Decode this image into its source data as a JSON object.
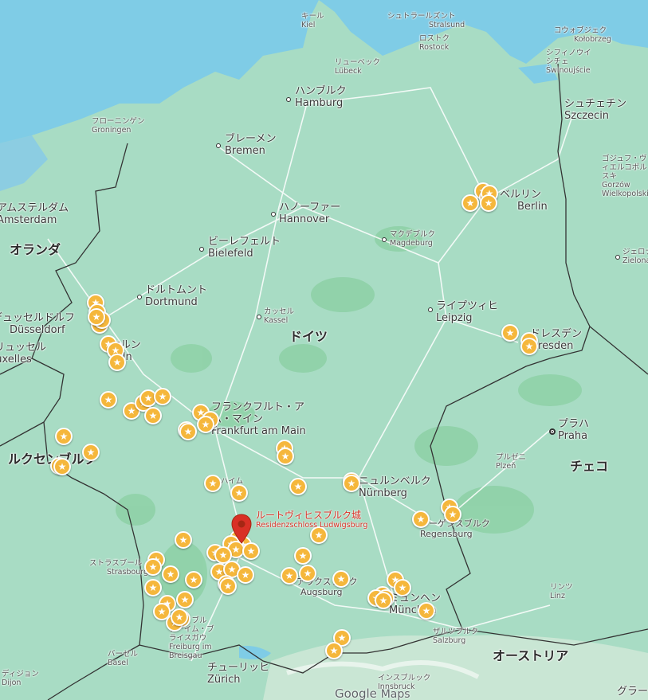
{
  "map": {
    "countries": [
      {
        "name": "ドイツ"
      },
      {
        "name": "オランダ"
      },
      {
        "name": "ルクセンブルク"
      },
      {
        "name": "チェコ"
      },
      {
        "name": "オーストリア"
      }
    ],
    "cities": [
      {
        "ja": "キール",
        "lat": "Kiel",
        "size": "s"
      },
      {
        "ja": "シュトラールズント",
        "lat": "Stralsund",
        "size": "s"
      },
      {
        "ja": "ロストク",
        "lat": "Rostock",
        "size": "s"
      },
      {
        "ja": "コウォブジェク",
        "lat": "Kołobrzeg",
        "size": "s"
      },
      {
        "ja": "シフィノウイシチェ",
        "lat": "Świnoujście",
        "size": "s"
      },
      {
        "ja": "リューベック",
        "lat": "Lübeck",
        "size": "s"
      },
      {
        "ja": "ハンブルク",
        "lat": "Hamburg",
        "size": "l"
      },
      {
        "ja": "シュチェチン",
        "lat": "Szczecin",
        "size": "l"
      },
      {
        "ja": "フローニンゲン",
        "lat": "Groningen",
        "size": "s"
      },
      {
        "ja": "ブレーメン",
        "lat": "Bremen",
        "size": "l"
      },
      {
        "ja": "ゴジュフ・ヴィエルコポルスキ",
        "lat": "Gorzów Wielkopolski",
        "size": "s"
      },
      {
        "ja": "ベルリン",
        "lat": "Berlin",
        "size": "l"
      },
      {
        "ja": "アムステルダム",
        "lat": "Amsterdam",
        "size": "l"
      },
      {
        "ja": "ハノーファー",
        "lat": "Hannover",
        "size": "l"
      },
      {
        "ja": "マクデブルク",
        "lat": "Magdeburg",
        "size": "s"
      },
      {
        "ja": "ビーレフェルト",
        "lat": "Bielefeld",
        "size": "l"
      },
      {
        "ja": "ジェロナ",
        "lat": "Zielona",
        "size": "s"
      },
      {
        "ja": "ドルトムント",
        "lat": "Dortmund",
        "size": "l"
      },
      {
        "ja": "カッセル",
        "lat": "Kassel",
        "size": "s"
      },
      {
        "ja": "ライプツィヒ",
        "lat": "Leipzig",
        "size": "l"
      },
      {
        "ja": "デュッセルドルフ",
        "lat": "Düsseldorf",
        "size": "l"
      },
      {
        "ja": "ケルン",
        "lat": "Köln",
        "size": "l"
      },
      {
        "ja": "ドレスデン",
        "lat": "Dresden",
        "size": "l"
      },
      {
        "ja": "ブリュッセル",
        "lat": "Bruxelles",
        "size": "l"
      },
      {
        "ja": "フランクフルト・アム・マイン",
        "lat": "Frankfurt am Main",
        "size": "l"
      },
      {
        "ja": "プラハ",
        "lat": "Praha",
        "size": "l"
      },
      {
        "ja": "プルゼニ",
        "lat": "Plzeň",
        "size": "s"
      },
      {
        "ja": "マンハイム",
        "lat": "Mannheim",
        "size": "s"
      },
      {
        "ja": "ニュルンベルク",
        "lat": "Nürnberg",
        "size": "l"
      },
      {
        "ja": "レーゲンスブルク",
        "lat": "Regensburg",
        "size": "m"
      },
      {
        "ja": "ストラスブール",
        "lat": "Strasbourg",
        "size": "s"
      },
      {
        "ja": "アウクスブルク",
        "lat": "Augsburg",
        "size": "m"
      },
      {
        "ja": "ミュンヘン",
        "lat": "München",
        "size": "l"
      },
      {
        "ja": "リンツ",
        "lat": "Linz",
        "size": "s"
      },
      {
        "ja": "フライブルク・イム・ブライスガウ",
        "lat": "Freiburg im Breisgau",
        "size": "s"
      },
      {
        "ja": "ザルツブルク",
        "lat": "Salzburg",
        "size": "s"
      },
      {
        "ja": "バーゼル",
        "lat": "Basel",
        "size": "s"
      },
      {
        "ja": "チューリッヒ",
        "lat": "Zürich",
        "size": "l"
      },
      {
        "ja": "インスブルック",
        "lat": "Innsbruck",
        "size": "s"
      },
      {
        "ja": "ディジョン",
        "lat": "Dijon",
        "size": "s"
      },
      {
        "ja": "グラーツ",
        "lat": "",
        "size": "l"
      }
    ],
    "selected_place": {
      "name_ja": "ルートヴィヒスブルク城",
      "name_de": "Residenzschloss Ludwigsburg",
      "marker_color": "#d93025"
    },
    "saved_place_marker": {
      "icon": "star-icon",
      "color": "#f5b73c"
    },
    "saved_places_count": 88,
    "attribution": {
      "google": "Google",
      "maps": "Maps"
    },
    "colors": {
      "land": "#a8dcc4",
      "water": "#7fcce6",
      "forest": "#8fd1a8",
      "border": "#333333",
      "road": "#ffffff"
    }
  }
}
